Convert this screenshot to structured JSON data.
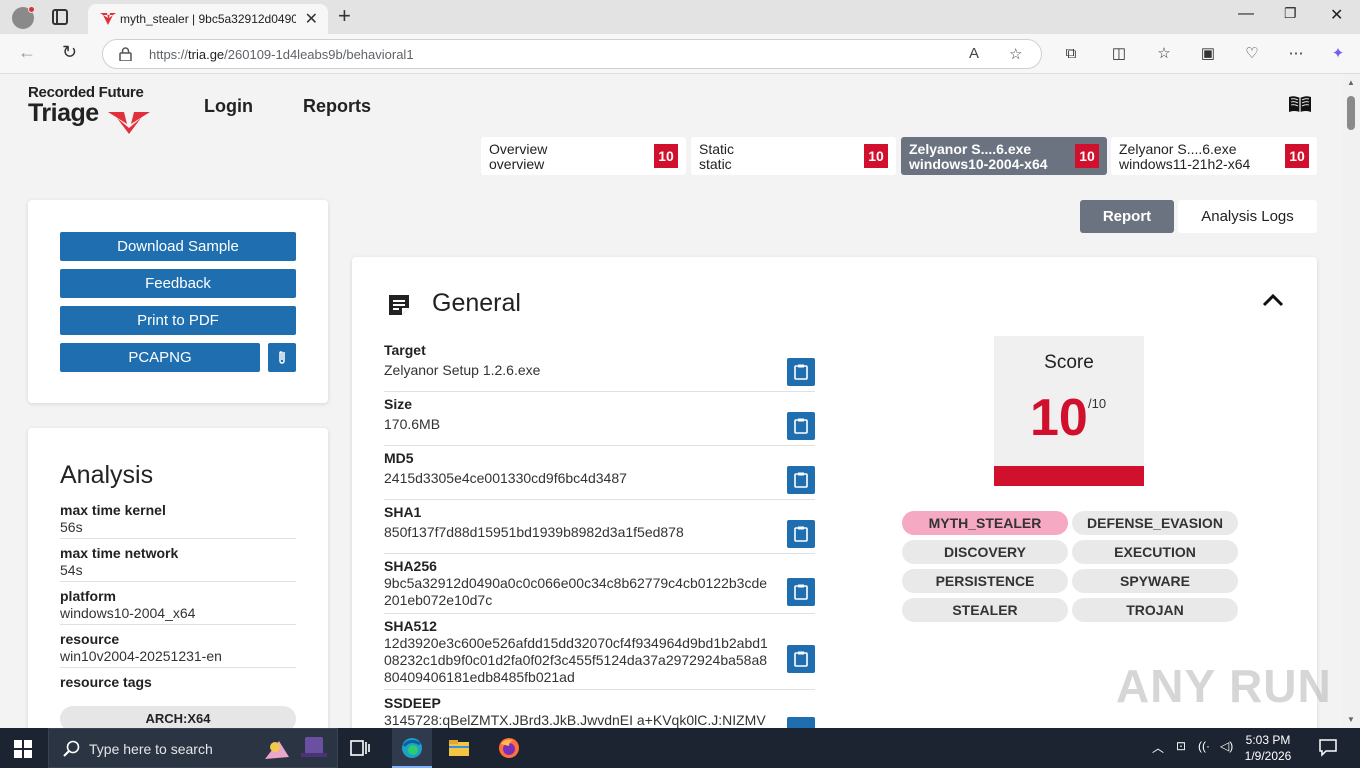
{
  "browser": {
    "tab_title": "myth_stealer | 9bc5a32912d0490a",
    "url_prefix": "https://",
    "url_host": "tria.ge",
    "url_path": "/260109-1d4leabs9b/behavioral1"
  },
  "header": {
    "brand_line1": "Recorded Future",
    "brand_line2": "Triage",
    "nav_login": "Login",
    "nav_reports": "Reports"
  },
  "report_tabs": [
    {
      "line1": "Overview",
      "line2": "overview",
      "score": "10"
    },
    {
      "line1": "Static",
      "line2": "static",
      "score": "10"
    },
    {
      "line1": "Zelyanor S....6.exe",
      "line2": "windows10-2004-x64",
      "score": "10"
    },
    {
      "line1": "Zelyanor S....6.exe",
      "line2": "windows11-21h2-x64",
      "score": "10"
    }
  ],
  "view_toggle": {
    "report": "Report",
    "logs": "Analysis Logs"
  },
  "actions": {
    "download": "Download Sample",
    "feedback": "Feedback",
    "print": "Print to PDF",
    "pcapng": "PCAPNG"
  },
  "analysis": {
    "title": "Analysis",
    "items": [
      {
        "key": "max time kernel",
        "value": "56s"
      },
      {
        "key": "max time network",
        "value": "54s"
      },
      {
        "key": "platform",
        "value": "windows10-2004_x64"
      },
      {
        "key": "resource",
        "value": "win10v2004-20251231-en"
      },
      {
        "key": "resource tags",
        "value": ""
      }
    ],
    "tag": "ARCH:X64"
  },
  "general": {
    "title": "General",
    "fields": [
      {
        "key": "Target",
        "value": "Zelyanor Setup 1.2.6.exe"
      },
      {
        "key": "Size",
        "value": "170.6MB"
      },
      {
        "key": "MD5",
        "value": "2415d3305e4ce001330cd9f6bc4d3487"
      },
      {
        "key": "SHA1",
        "value": "850f137f7d88d15951bd1939b8982d3a1f5ed878"
      },
      {
        "key": "SHA256",
        "value": "9bc5a32912d0490a0c0c066e00c34c8b62779c4cb0122b3cde201eb072e10d7c"
      },
      {
        "key": "SHA512",
        "value": "12d3920e3c600e526afdd15dd32070cf4f934964d9bd1b2abd108232c1db9f0c01d2fa0f02f3c455f5124da37a2972924ba58a880409406181edb8485fb021ad"
      },
      {
        "key": "SSDEEP",
        "value": "3145728:qBelZMTX.JBrd3.JkB.JwvdnEI a+KVqk0lC.J:NIZMV"
      }
    ],
    "score_label": "Score",
    "score_value": "10",
    "score_max": "/10",
    "signatures": [
      "MYTH_STEALER",
      "DEFENSE_EVASION",
      "DISCOVERY",
      "EXECUTION",
      "PERSISTENCE",
      "SPYWARE",
      "STEALER",
      "TROJAN"
    ]
  },
  "watermark": "ANY RUN",
  "taskbar": {
    "search_placeholder": "Type here to search",
    "time": "5:03 PM",
    "date": "1/9/2026"
  },
  "colors": {
    "accent_blue": "#1f6fb0",
    "danger_red": "#d0102c",
    "tag_pink": "#f5a9c3"
  }
}
